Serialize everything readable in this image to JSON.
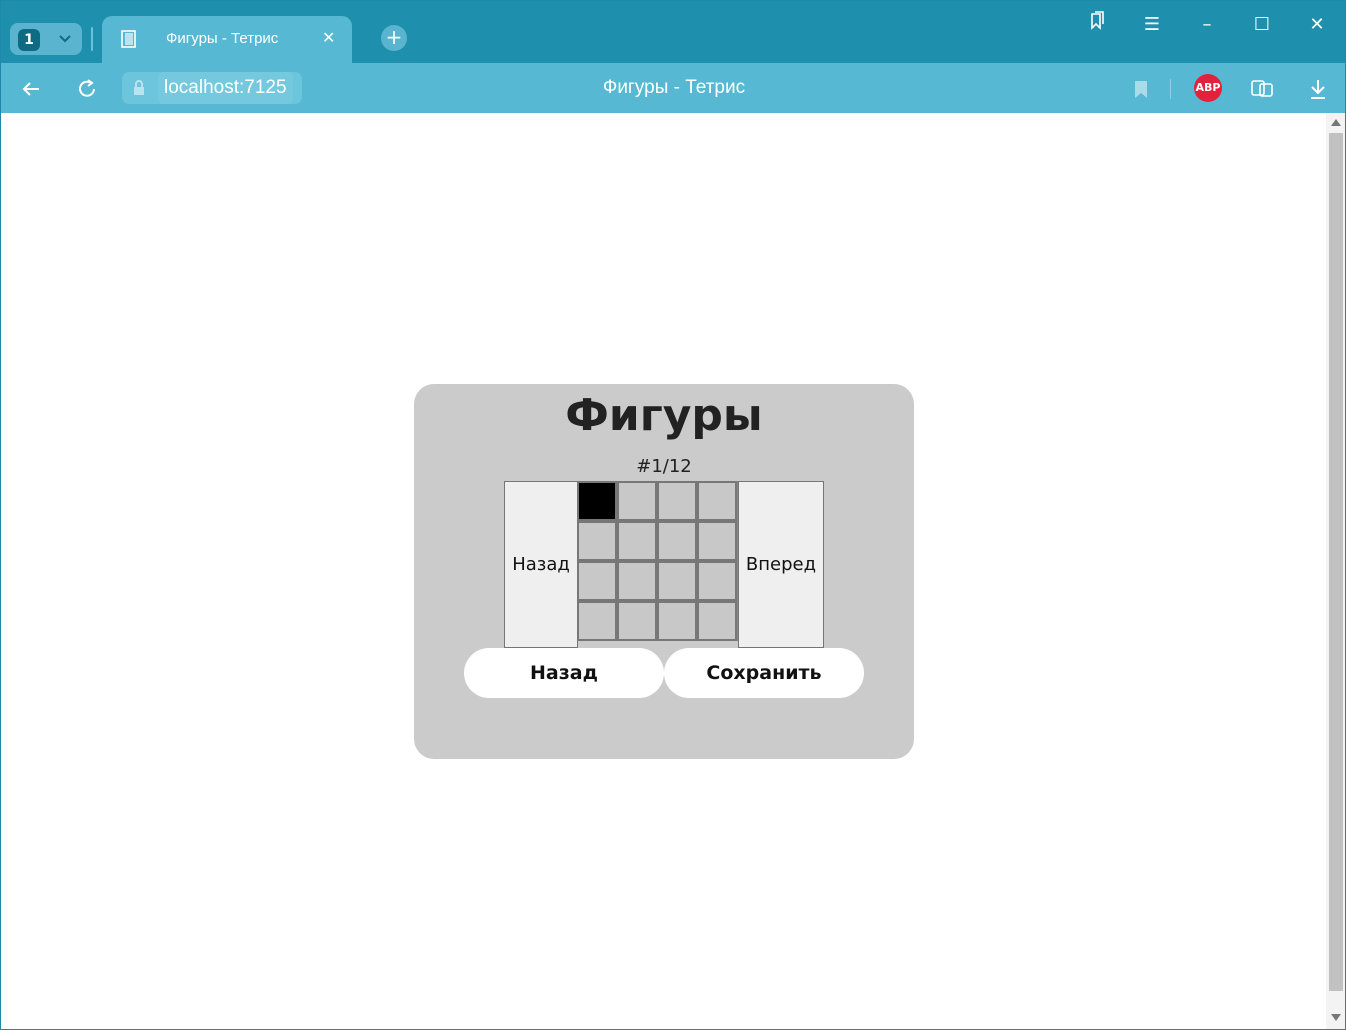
{
  "browser": {
    "tab_count": "1",
    "tab_title": "Фигуры - Тетрис",
    "url": "localhost:7125",
    "page_title": "Фигуры - Тетрис",
    "abp_label": "ABP",
    "accent_color": "#1e8fad",
    "toolbar_color": "#56b8d3"
  },
  "app": {
    "title": "Фигуры",
    "counter": "#1/12",
    "prev_label": "Назад",
    "next_label": "Вперед",
    "back_label": "Назад",
    "save_label": "Сохранить",
    "grid": [
      [
        1,
        0,
        0,
        0
      ],
      [
        0,
        0,
        0,
        0
      ],
      [
        0,
        0,
        0,
        0
      ],
      [
        0,
        0,
        0,
        0
      ]
    ]
  }
}
